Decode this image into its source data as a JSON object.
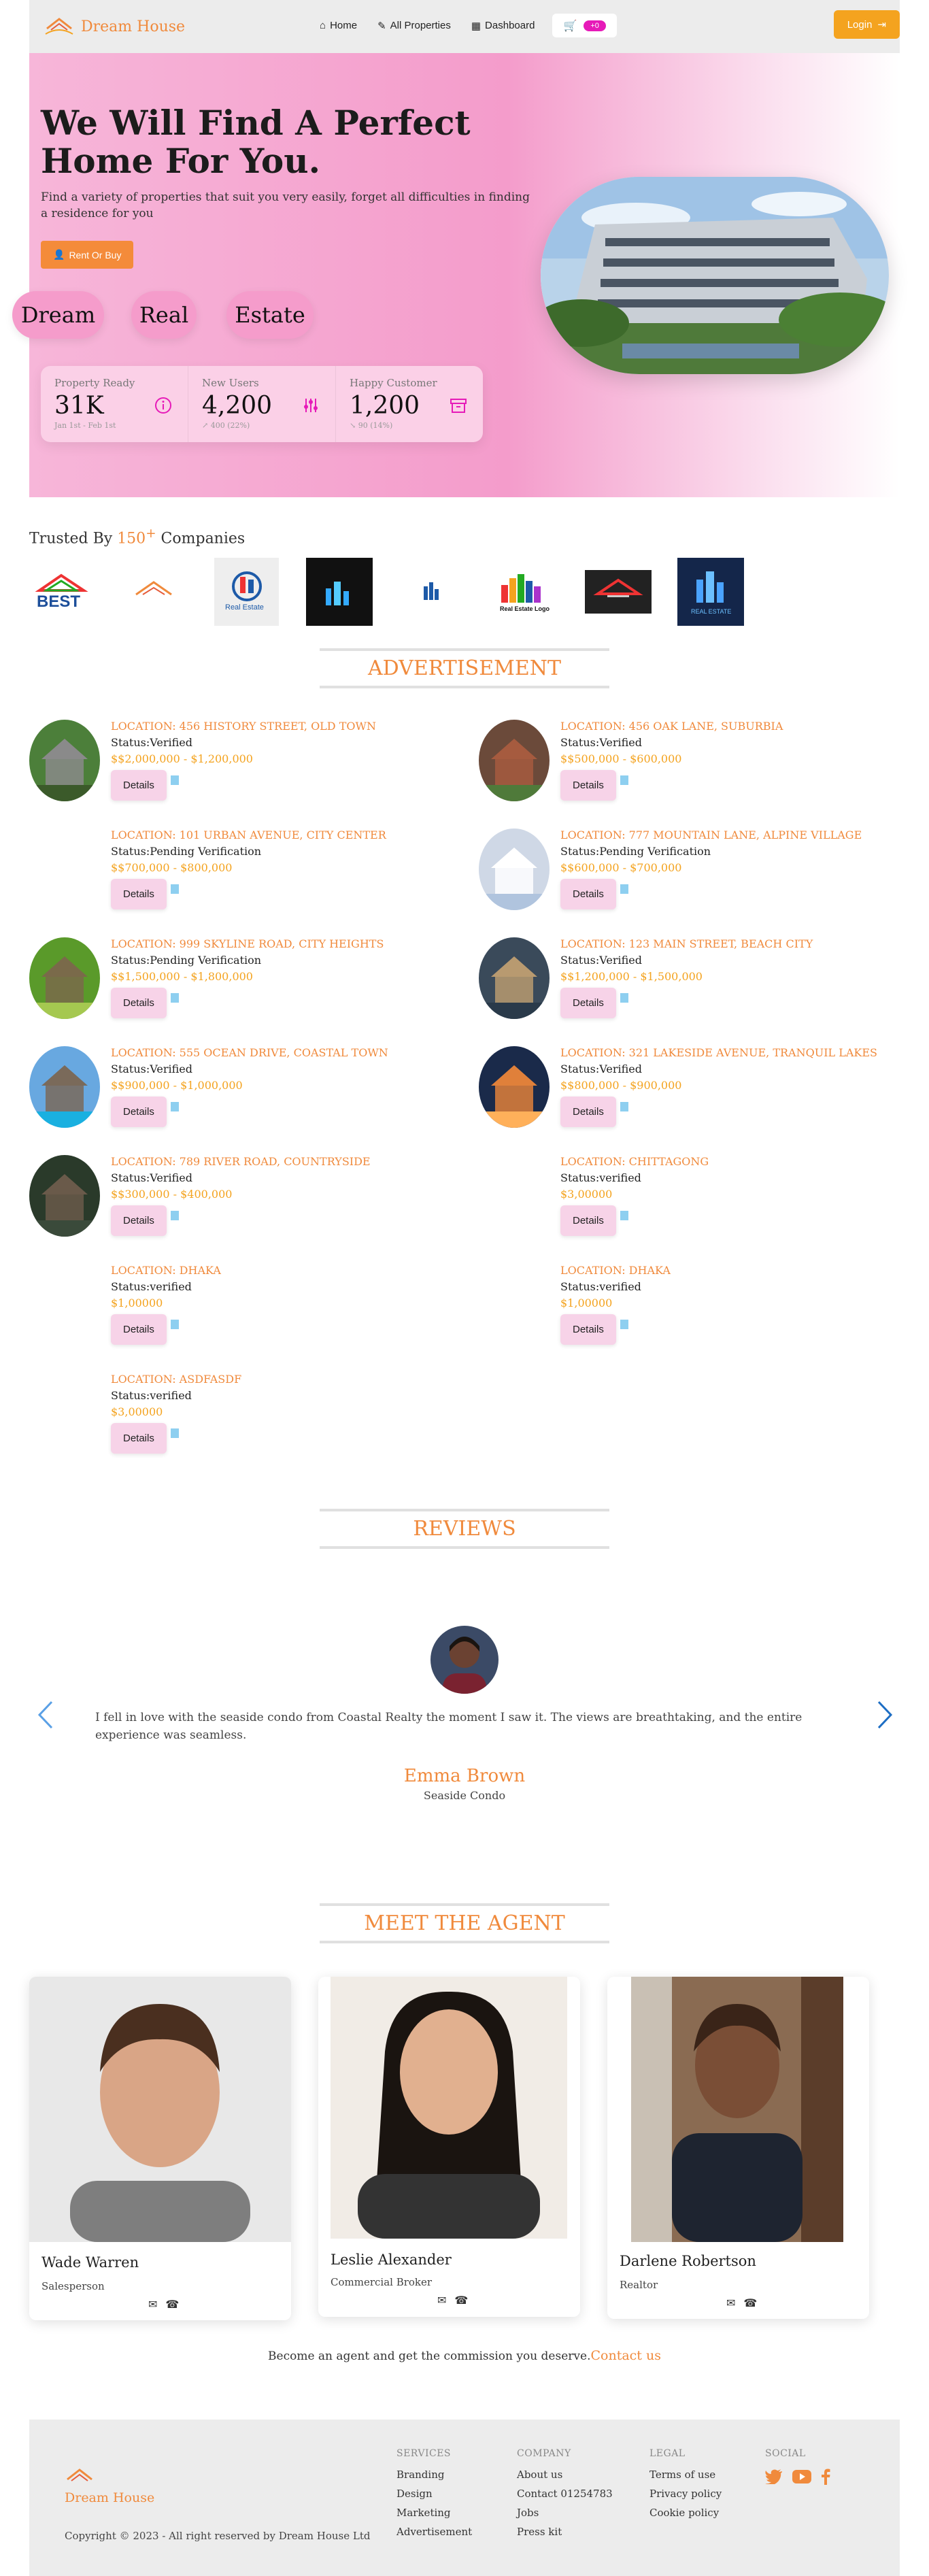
{
  "nav": {
    "brand": "Dream House",
    "links": [
      "Home",
      "All Properties",
      "Dashboard"
    ],
    "cart_count": "+0",
    "login": "Login"
  },
  "hero": {
    "title": "We Will Find A Perfect Home For You.",
    "subtitle": "Find a variety of properties that suit you very easily, forget all difficulties in finding a residence for you",
    "cta": "Rent Or Buy",
    "tags": [
      "Dream",
      "Real",
      "Estate"
    ],
    "stats": [
      {
        "label": "Property Ready",
        "value": "31K",
        "note": "Jan 1st - Feb 1st"
      },
      {
        "label": "New Users",
        "value": "4,200",
        "note": "↗ 400 (22%)"
      },
      {
        "label": "Happy Customer",
        "value": "1,200",
        "note": "↘ 90 (14%)"
      }
    ]
  },
  "trusted": {
    "prefix": "Trusted By",
    "count": "150",
    "plus": "+",
    "suffix": "Companies"
  },
  "logo_texts": [
    "BEST",
    "Real Estate",
    "Real Estate Logo",
    "REAL ESTATE"
  ],
  "ads_title": "ADVERTISEMENT",
  "ads": [
    {
      "loc": "LOCATION: 456 HISTORY STREET, OLD TOWN",
      "status": "Status:Verified",
      "price": "$$2,000,000 - $1,200,000",
      "btn": "Details"
    },
    {
      "loc": "LOCATION: 456 OAK LANE, SUBURBIA",
      "status": "Status:Verified",
      "price": "$$500,000 - $600,000",
      "btn": "Details"
    },
    {
      "loc": "LOCATION: 101 URBAN AVENUE, CITY CENTER",
      "status": "Status:Pending Verification",
      "price": "$$700,000 - $800,000",
      "btn": "Details"
    },
    {
      "loc": "LOCATION: 777 MOUNTAIN LANE, ALPINE VILLAGE",
      "status": "Status:Pending Verification",
      "price": "$$600,000 - $700,000",
      "btn": "Details"
    },
    {
      "loc": "LOCATION: 999 SKYLINE ROAD, CITY HEIGHTS",
      "status": "Status:Pending Verification",
      "price": "$$1,500,000 - $1,800,000",
      "btn": "Details"
    },
    {
      "loc": "LOCATION: 123 MAIN STREET, BEACH CITY",
      "status": "Status:Verified",
      "price": "$$1,200,000 - $1,500,000",
      "btn": "Details"
    },
    {
      "loc": "LOCATION: 555 OCEAN DRIVE, COASTAL TOWN",
      "status": "Status:Verified",
      "price": "$$900,000 - $1,000,000",
      "btn": "Details"
    },
    {
      "loc": "LOCATION: 321 LAKESIDE AVENUE, TRANQUIL LAKES",
      "status": "Status:Verified",
      "price": "$$800,000 - $900,000",
      "btn": "Details"
    },
    {
      "loc": "LOCATION: 789 RIVER ROAD, COUNTRYSIDE",
      "status": "Status:Verified",
      "price": "$$300,000 - $400,000",
      "btn": "Details"
    },
    {
      "loc": "LOCATION: CHITTAGONG",
      "status": "Status:verified",
      "price": "$3,00000",
      "btn": "Details"
    },
    {
      "loc": "LOCATION: DHAKA",
      "status": "Status:verified",
      "price": "$1,00000",
      "btn": "Details"
    },
    {
      "loc": "LOCATION: DHAKA",
      "status": "Status:verified",
      "price": "$1,00000",
      "btn": "Details"
    },
    {
      "loc": "LOCATION: ASDFASDF",
      "status": "Status:verified",
      "price": "$3,00000",
      "btn": "Details"
    }
  ],
  "reviews_title": "REVIEWS",
  "review": {
    "text": "I fell in love with the seaside condo from Coastal Realty the moment I saw it. The views are breathtaking, and the entire experience was seamless.",
    "name": "Emma Brown",
    "product": "Seaside Condo"
  },
  "agents_title": "MEET THE AGENT",
  "agents": [
    {
      "name": "Wade Warren",
      "role": "Salesperson"
    },
    {
      "name": "Leslie Alexander",
      "role": "Commercial Broker"
    },
    {
      "name": "Darlene Robertson",
      "role": "Realtor"
    }
  ],
  "cta": {
    "text": "Become an agent and get the commission you deserve.",
    "link": "Contact us"
  },
  "footer": {
    "brand": "Dream House",
    "copyright": "Copyright © 2023 - All right reserved by Dream House Ltd",
    "services": {
      "head": "SERVICES",
      "items": [
        "Branding",
        "Design",
        "Marketing",
        "Advertisement"
      ]
    },
    "company": {
      "head": "COMPANY",
      "items": [
        "About us",
        "Contact 01254783",
        "Jobs",
        "Press kit"
      ]
    },
    "legal": {
      "head": "LEGAL",
      "items": [
        "Terms of use",
        "Privacy policy",
        "Cookie policy"
      ]
    },
    "social": {
      "head": "SOCIAL"
    }
  },
  "colors": {
    "accent": "#f08a3c",
    "pink": "#f49ccb",
    "button": "#f4a31f"
  }
}
